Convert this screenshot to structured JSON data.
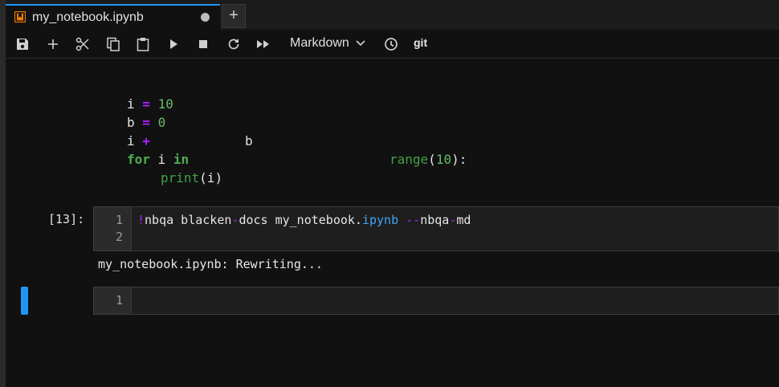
{
  "tab": {
    "title": "my_notebook.ipynb",
    "add_label": "+"
  },
  "toolbar": {
    "icons": [
      "save-icon",
      "add-icon",
      "cut-icon",
      "copy-icon",
      "paste-icon",
      "run-icon",
      "stop-icon",
      "restart-icon",
      "fast-forward-icon",
      "clock-icon"
    ],
    "cell_type": "Markdown",
    "git_label": "git"
  },
  "markdown_cell": {
    "line1": {
      "a": "i",
      "op": "=",
      "num": "10"
    },
    "line2": {
      "a": "b",
      "op": "=",
      "num": "0"
    },
    "line3": {
      "a": "i",
      "op": "+",
      "b": "b"
    },
    "line4": {
      "kw": "for",
      "var": "i",
      "kw2": "in",
      "fn": "range",
      "open": "(",
      "num": "10",
      "close": "):"
    },
    "line5": {
      "fn": "print",
      "args": "(i)"
    }
  },
  "code_cell": {
    "prompt": "[13]:",
    "line_numbers": [
      "1",
      "2"
    ],
    "bang": "!",
    "cmd": "nbqa blacken",
    "dash1": "-",
    "docs": "docs my_notebook.",
    "ext": "ipynb",
    "space": " ",
    "flag_dashes": "--",
    "flag_a": "nbqa",
    "dash2": "-",
    "flag_b": "md"
  },
  "output": {
    "text": "my_notebook.ipynb: Rewriting..."
  },
  "empty_cell": {
    "line_number": "1"
  },
  "colors": {
    "accent": "#2196f3",
    "keyword": "#4caf50",
    "operator": "#aa22ff",
    "attribute": "#42a5f5"
  }
}
